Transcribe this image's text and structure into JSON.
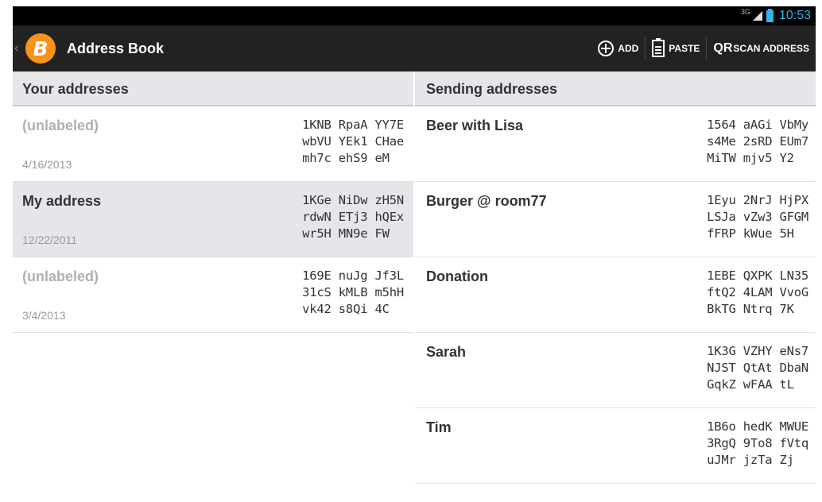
{
  "status_bar": {
    "network": "3G",
    "time": "10:53"
  },
  "action_bar": {
    "title": "Address Book",
    "logo_symbol": "B",
    "actions": {
      "add": "ADD",
      "paste": "PASTE",
      "qr_prefix": "QR",
      "scan": "SCAN ADDRESS"
    }
  },
  "your_addresses": {
    "title": "Your addresses",
    "items": [
      {
        "label": "(unlabeled)",
        "date": "4/16/2013",
        "address": "1KNB RpaA YY7E\nwbVU YEk1 CHae\nmh7c ehS9 eM"
      },
      {
        "label": "My address",
        "date": "12/22/2011",
        "address": "1KGe NiDw zH5N\nrdwN ETj3 hQEx\nwr5H MN9e FW"
      },
      {
        "label": "(unlabeled)",
        "date": "3/4/2013",
        "address": "169E nuJg Jf3L\n31cS kMLB m5hH\nvk42 s8Qi 4C"
      }
    ]
  },
  "sending_addresses": {
    "title": "Sending addresses",
    "items": [
      {
        "label": "Beer with Lisa",
        "address": "1564 aAGi VbMy\ns4Me 2sRD EUm7\nMiTW mjv5 Y2"
      },
      {
        "label": "Burger @ room77",
        "address": "1Eyu 2NrJ HjPX\nLSJa vZw3 GFGM\nfFRP kWue 5H"
      },
      {
        "label": "Donation",
        "address": "1EBE QXPK LN35\nftQ2 4LAM VvoG\nBkTG Ntrq 7K"
      },
      {
        "label": "Sarah",
        "address": "1K3G VZHY eNs7\nNJST QtAt DbaN\nGqkZ wFAA tL"
      },
      {
        "label": "Tim",
        "address": "1B6o hedK MWUE\n3RgQ 9To8 fVtq\nuJMr jzTa Zj"
      }
    ]
  },
  "colors": {
    "accent": "#33b5e5",
    "bitcoin": "#f7931a",
    "action_bar": "#222222",
    "header_bg": "#e6e6ea"
  }
}
